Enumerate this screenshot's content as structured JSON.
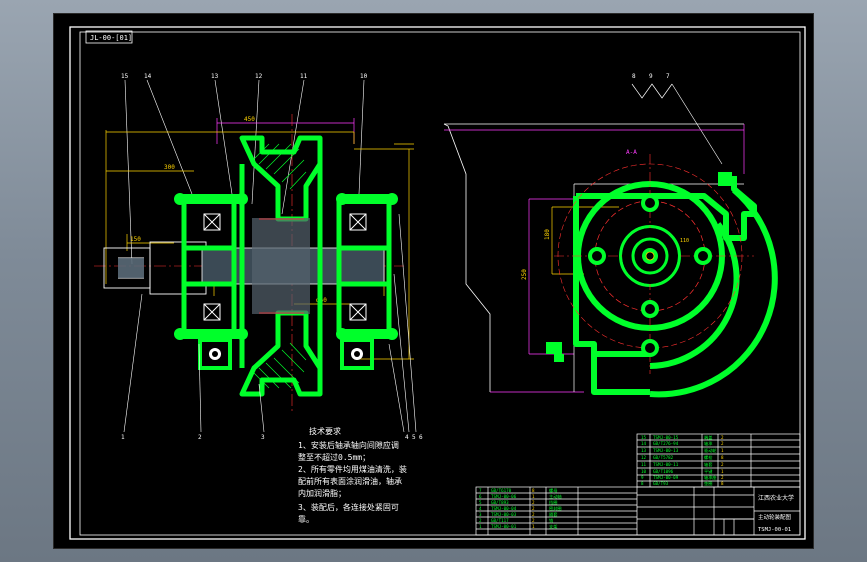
{
  "drawing_number_tag": "JL-00-[01]",
  "university": "江西农业大学",
  "drawing_title": "主动轮装配图",
  "drawing_code": "TSMJ-00-01",
  "section_marker": "A-A",
  "leader_numbers": {
    "top": [
      "15",
      "14",
      "13",
      "12",
      "11",
      "10"
    ],
    "bottom": [
      "1",
      "2",
      "3",
      "4",
      "5",
      "6"
    ],
    "right_view": [
      "8",
      "9",
      "7"
    ]
  },
  "dimensions": {
    "left_top_1": "450",
    "left_top_2": "300",
    "shaft_height": "150",
    "bore": "φ60",
    "right_vertical_1": "250",
    "right_vertical_2": "180",
    "center_label": "110"
  },
  "tech_requirements": {
    "title": "技术要求",
    "lines": [
      "1、安装后轴承轴向间隙应调",
      "整至不超过0.5mm；",
      "2、所有零件均用煤油清洗，装",
      "配前所有表面涂润滑油，轴承",
      "内加润滑脂；",
      "3、装配后，各连接处紧固可",
      "靠。"
    ]
  },
  "bom_rows": [
    {
      "no": "15",
      "code": "TSMJ-00-15",
      "name": "端盖",
      "qty": "2"
    },
    {
      "no": "14",
      "code": "GB/T276-94",
      "name": "轴承",
      "qty": "2"
    },
    {
      "no": "13",
      "code": "TSMJ-00-13",
      "name": "驱动轮",
      "qty": "1"
    },
    {
      "no": "12",
      "code": "GB/T5782",
      "name": "螺栓",
      "qty": "8"
    },
    {
      "no": "11",
      "code": "TSMJ-00-11",
      "name": "轴套",
      "qty": "2"
    },
    {
      "no": "10",
      "code": "GB/T1096",
      "name": "平键",
      "qty": "1"
    },
    {
      "no": "9",
      "code": "TSMJ-00-09",
      "name": "轴承座",
      "qty": "2"
    },
    {
      "no": "8",
      "code": "GB/T93",
      "name": "垫圈",
      "qty": "8"
    },
    {
      "no": "7",
      "code": "GB/T6170",
      "name": "螺母",
      "qty": "8"
    },
    {
      "no": "6",
      "code": "TSMJ-00-06",
      "name": "主动轴",
      "qty": "1"
    },
    {
      "no": "5",
      "code": "GB/T893",
      "name": "挡圈",
      "qty": "2"
    },
    {
      "no": "4",
      "code": "TSMJ-00-04",
      "name": "密封圈",
      "qty": "2"
    },
    {
      "no": "3",
      "code": "TSMJ-00-03",
      "name": "隔套",
      "qty": "2"
    },
    {
      "no": "2",
      "code": "GB/T117",
      "name": "销",
      "qty": "2"
    },
    {
      "no": "1",
      "code": "TSMJ-00-01",
      "name": "支架",
      "qty": "1"
    }
  ]
}
